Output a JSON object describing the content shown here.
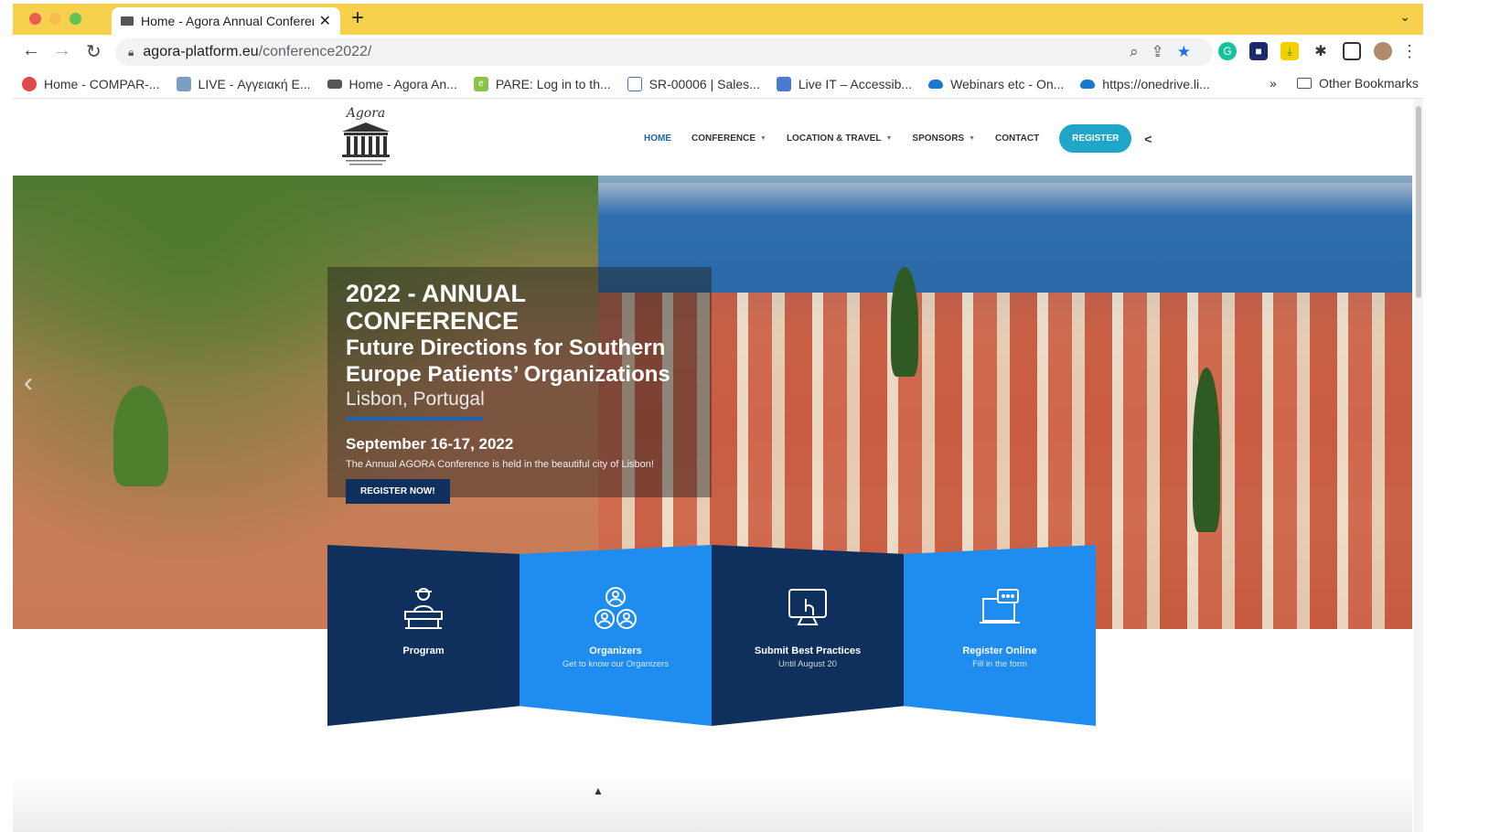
{
  "browser": {
    "tab": {
      "title": "Home - Agora Annual Conferen"
    },
    "address": {
      "host": "agora-platform.eu",
      "path": "/conference2022/"
    },
    "bookmarks": [
      {
        "label": "Home - COMPAR-...",
        "icon": "compar-icon",
        "color": "#e24a4a"
      },
      {
        "label": "LIVE - Αγγειακή Ε...",
        "icon": "leaf-icon",
        "color": "#7a9ec4"
      },
      {
        "label": "Home - Agora An...",
        "icon": "agora-icon",
        "color": "#555555"
      },
      {
        "label": "PARE: Log in to th...",
        "icon": "pare-icon",
        "color": "#8bc34a"
      },
      {
        "label": "SR-00006 | Sales...",
        "icon": "sr-icon",
        "color": "#4f6fa8"
      },
      {
        "label": "Live IT – Accessib...",
        "icon": "liveit-icon",
        "color": "#4a7bd0"
      },
      {
        "label": "Webinars etc - On...",
        "icon": "onedrive-icon",
        "color": "#1976d2"
      },
      {
        "label": "https://onedrive.li...",
        "icon": "onedrive-icon",
        "color": "#1976d2"
      }
    ],
    "bookmarks_more": "»",
    "bookmarks_other": "Other Bookmarks"
  },
  "site": {
    "logo_text": "Agora",
    "nav": [
      {
        "label": "HOME",
        "active": true,
        "dropdown": false
      },
      {
        "label": "CONFERENCE",
        "active": false,
        "dropdown": true
      },
      {
        "label": "LOCATION & TRAVEL",
        "active": false,
        "dropdown": true
      },
      {
        "label": "SPONSORS",
        "active": false,
        "dropdown": true
      },
      {
        "label": "CONTACT",
        "active": false,
        "dropdown": false
      }
    ],
    "register_label": "REGISTER"
  },
  "hero": {
    "title": "2022 - ANNUAL CONFERENCE",
    "subtitle_line1": "Future Directions for Southern",
    "subtitle_line2": "Europe Patients’ Organizations",
    "location": "Lisbon, Portugal",
    "date": "September 16-17, 2022",
    "description": "The Annual AGORA Conference is held in the beautiful city of Lisbon!",
    "cta_label": "REGISTER NOW!"
  },
  "features": [
    {
      "title": "Program",
      "sub": "",
      "icon": "lecturer-icon"
    },
    {
      "title": "Organizers",
      "sub": "Get to know our Organizers",
      "icon": "people-icon"
    },
    {
      "title": "Submit Best Practices",
      "sub": "Until August 20",
      "icon": "touch-screen-icon"
    },
    {
      "title": "Register Online",
      "sub": "Fill in the form",
      "icon": "laptop-chat-icon"
    }
  ],
  "colors": {
    "primary_dark": "#0f2f5c",
    "primary_light": "#1f8cf0",
    "accent": "#1fa6c9",
    "tabbar": "#f7d04d"
  }
}
